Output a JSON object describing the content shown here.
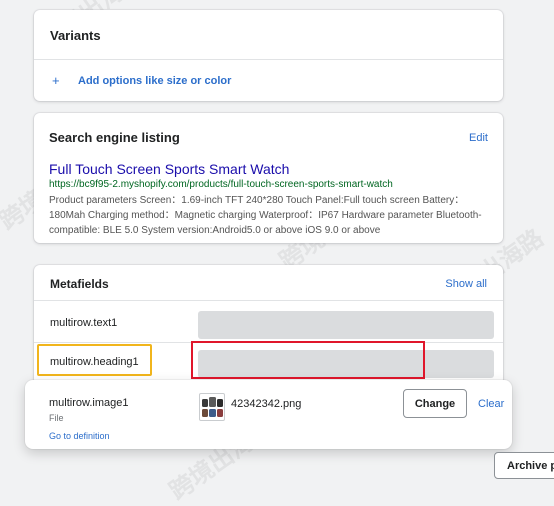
{
  "variants": {
    "title": "Variants",
    "add_icon": "+",
    "add_label": "Add options like size or color"
  },
  "seo": {
    "title": "Search engine listing",
    "edit_label": "Edit",
    "page_title": "Full Touch Screen Sports Smart Watch",
    "url": "https://bc9f95-2.myshopify.com/products/full-touch-screen-sports-smart-watch",
    "description": "Product parameters Screen：1.69-inch TFT 240*280 Touch Panel:Full touch screen Battery：180Mah Charging method：Magnetic charging Waterproof：IP67 Hardware parameter Bluetooth-compatible: BLE 5.0 System version:Android5.0 or above iOS 9.0 or above"
  },
  "metafields": {
    "title": "Metafields",
    "show_all_label": "Show all",
    "rows": [
      {
        "label": "multirow.text1"
      },
      {
        "label": "multirow.heading1"
      }
    ]
  },
  "popup": {
    "name": "multirow.image1",
    "type": "File",
    "goto_label": "Go to definition",
    "file_name": "42342342.png",
    "change_label": "Change",
    "clear_label": "Clear"
  },
  "archive_label": "Archive p",
  "watermark": "跨境出海路",
  "colors": {
    "link": "#2c6ecb",
    "seo_title": "#1a0dab",
    "seo_url": "#006621",
    "highlight_yellow": "#f1b51c",
    "highlight_red": "#e0162b"
  }
}
